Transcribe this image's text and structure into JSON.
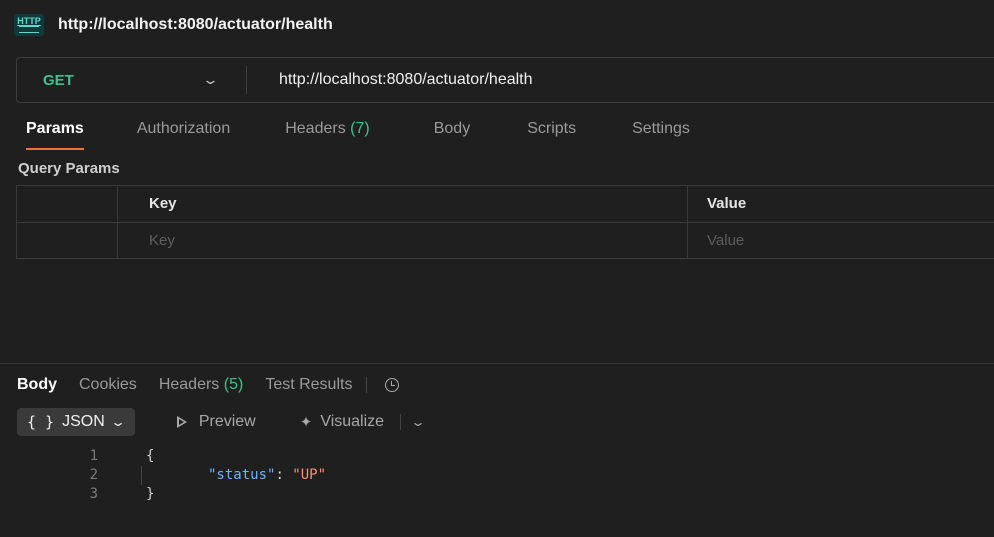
{
  "header": {
    "badge": "HTTP",
    "request_name": "http://localhost:8080/actuator/health"
  },
  "request": {
    "method": "GET",
    "url": "http://localhost:8080/actuator/health"
  },
  "request_tabs": {
    "params": "Params",
    "authorization": "Authorization",
    "headers": "Headers",
    "headers_count": "(7)",
    "body": "Body",
    "scripts": "Scripts",
    "settings": "Settings"
  },
  "query_params": {
    "title": "Query Params",
    "columns": {
      "key": "Key",
      "value": "Value"
    },
    "placeholders": {
      "key": "Key",
      "value": "Value"
    }
  },
  "response_tabs": {
    "body": "Body",
    "cookies": "Cookies",
    "headers": "Headers",
    "headers_count": "(5)",
    "test_results": "Test Results"
  },
  "view_options": {
    "format_braces": "{ }",
    "format": "JSON",
    "preview": "Preview",
    "visualize": "Visualize"
  },
  "response_body": {
    "line_numbers": [
      "1",
      "2",
      "3"
    ],
    "open_brace": "{",
    "key": "\"status\"",
    "colon": ": ",
    "value": "\"UP\"",
    "close_brace": "}"
  },
  "colors": {
    "accent": "#ff6c37",
    "method_get": "#3cc38d",
    "count": "#3cc38d",
    "json_key": "#6fb3ff",
    "json_string": "#ff8a7a"
  }
}
